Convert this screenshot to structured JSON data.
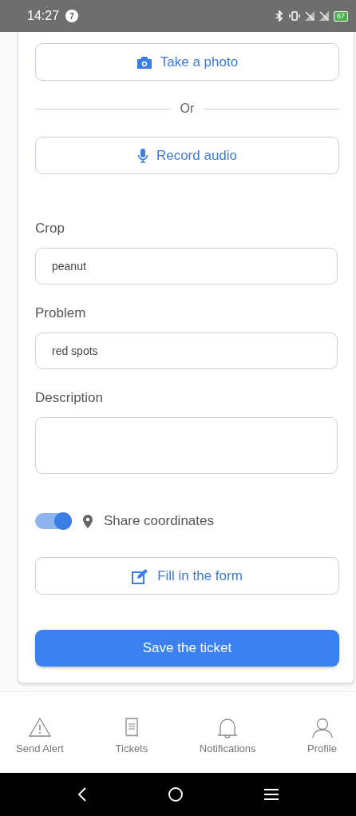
{
  "status_bar": {
    "time": "14:27",
    "notification_count": "7",
    "battery": "67"
  },
  "media_buttons": [
    {
      "kind": "photo",
      "label": "Take a photo"
    },
    {
      "kind": "audio",
      "label": "Record audio"
    }
  ],
  "divider_text": "Or",
  "fields": [
    {
      "label": "Crop",
      "value": "peanut",
      "kind": "input"
    },
    {
      "label": "Problem",
      "value": "red spots",
      "kind": "input"
    },
    {
      "label": "Description",
      "kind": "textarea"
    }
  ],
  "share_coordinates": {
    "label": "Share coordinates",
    "on": true
  },
  "form_button": "Fill in the form",
  "save_button": "Save the ticket",
  "bottom_nav": [
    {
      "kind": "alert",
      "label": "Send Alert",
      "selected": false
    },
    {
      "kind": "tickets",
      "label": "Tickets",
      "selected": false
    },
    {
      "kind": "notifications",
      "label": "Notifications",
      "selected": false
    },
    {
      "kind": "profile",
      "label": "Profile",
      "selected": false
    }
  ]
}
